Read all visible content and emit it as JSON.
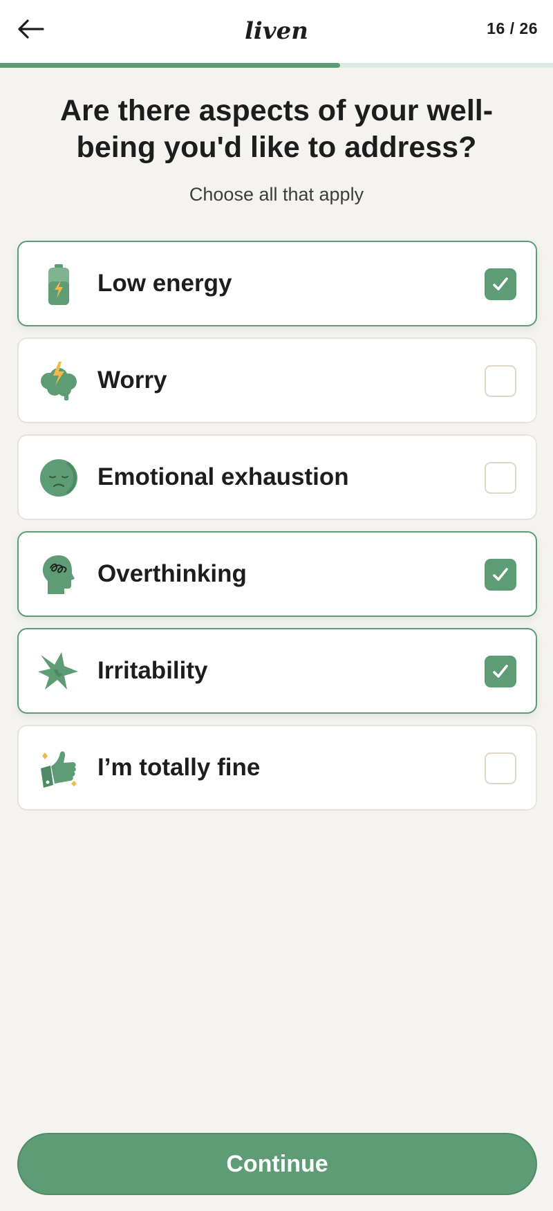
{
  "header": {
    "back_icon": "arrow-left-icon",
    "logo_text": "liven",
    "step_counter": "16 / 26"
  },
  "progress": {
    "current": 16,
    "total": 26,
    "fraction": 0.6154
  },
  "question": {
    "title": "Are there aspects of your well-being you'd like to address?",
    "subtitle": "Choose all that apply"
  },
  "options": [
    {
      "label": "Low energy",
      "icon": "battery-icon",
      "selected": true
    },
    {
      "label": "Worry",
      "icon": "brain-lightning-icon",
      "selected": false
    },
    {
      "label": "Emotional exhaustion",
      "icon": "sad-face-icon",
      "selected": false
    },
    {
      "label": "Overthinking",
      "icon": "head-scribble-icon",
      "selected": true
    },
    {
      "label": "Irritability",
      "icon": "burst-icon",
      "selected": true
    },
    {
      "label": "I’m totally fine",
      "icon": "thumbs-up-icon",
      "selected": false
    }
  ],
  "footer": {
    "continue_label": "Continue"
  },
  "colors": {
    "accent": "#5d9c74",
    "background": "#f4f3f0",
    "card": "#ffffff",
    "accent_light": "#dde9e2",
    "highlight": "#f2b84b"
  }
}
